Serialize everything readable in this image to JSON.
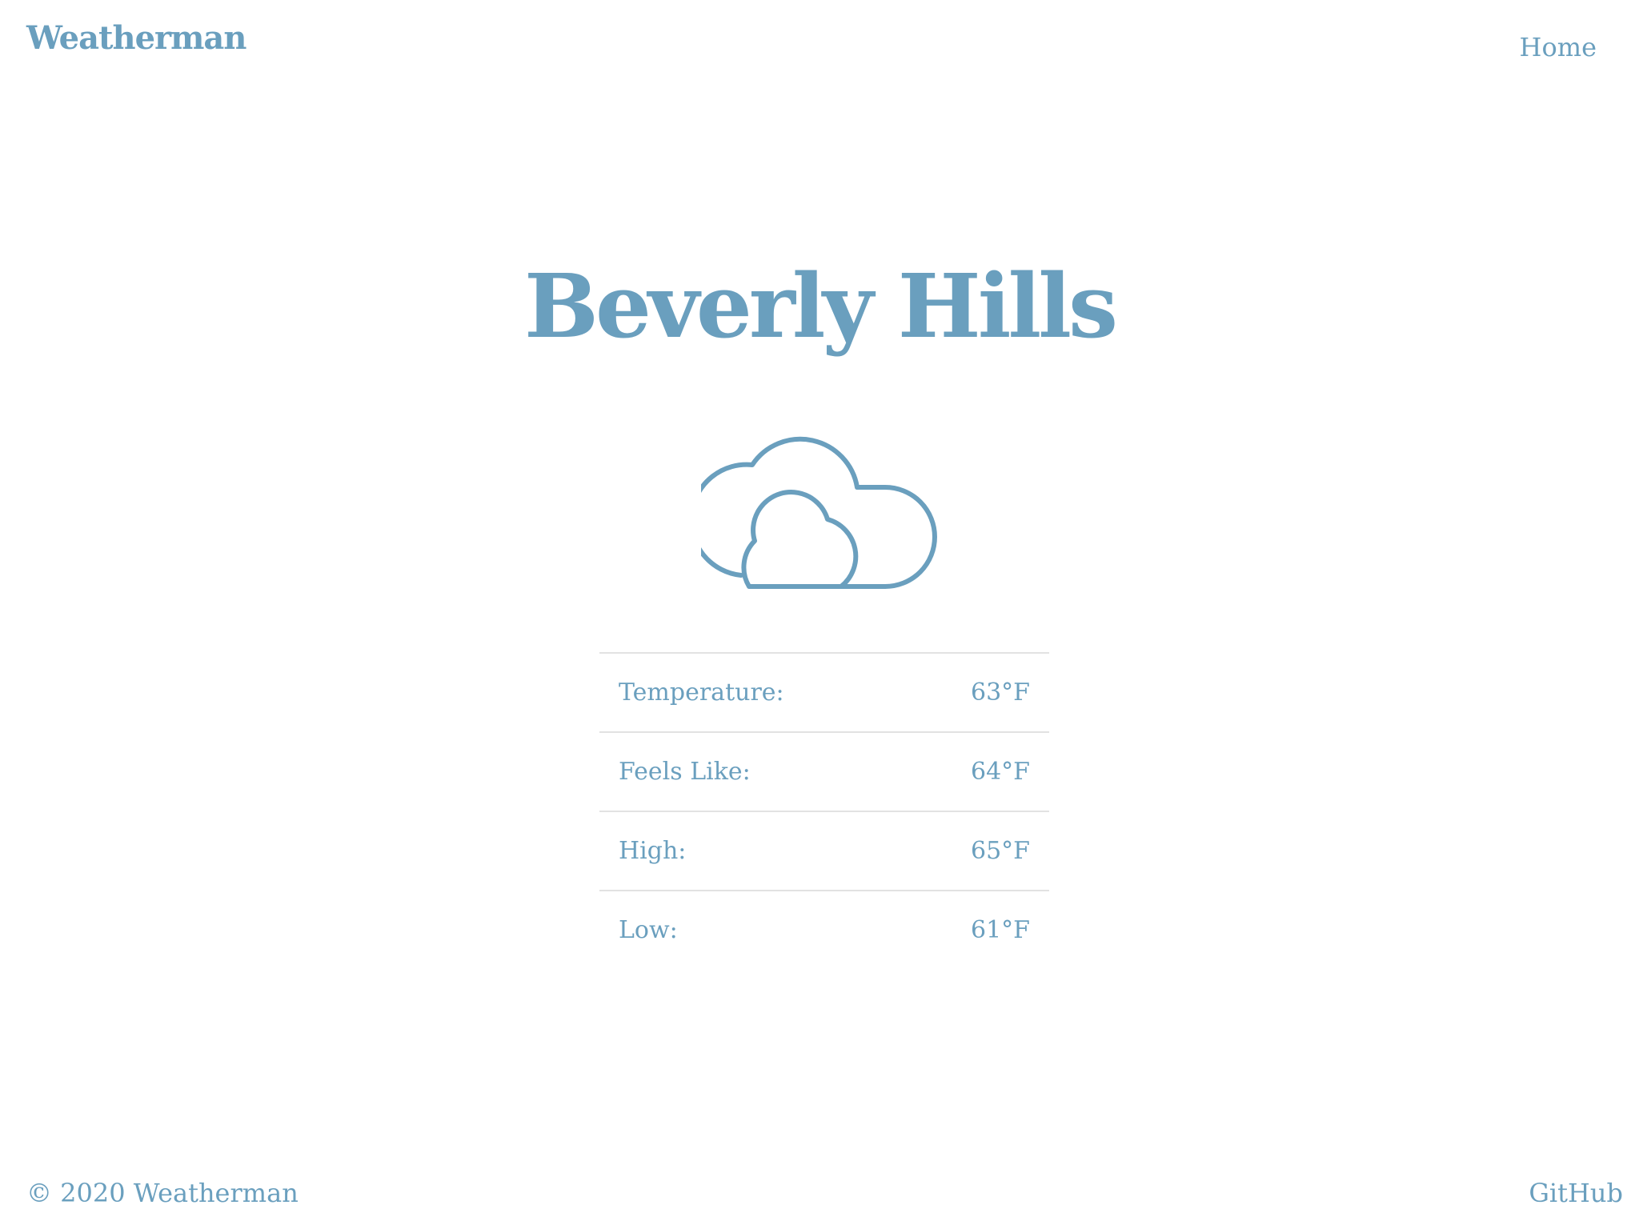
{
  "header": {
    "brand": "Weatherman",
    "nav_home": "Home"
  },
  "main": {
    "city": "Beverly Hills",
    "icon": "cloudy-icon",
    "stats": [
      {
        "label": "Temperature:",
        "value": "63°F"
      },
      {
        "label": "Feels Like:",
        "value": "64°F"
      },
      {
        "label": "High:",
        "value": "65°F"
      },
      {
        "label": "Low:",
        "value": "61°F"
      }
    ]
  },
  "footer": {
    "copyright": "© 2020 Weatherman",
    "github": "GitHub"
  },
  "colors": {
    "accent": "#6a9fbe",
    "divider": "#e2e2e2",
    "background": "#ffffff"
  }
}
